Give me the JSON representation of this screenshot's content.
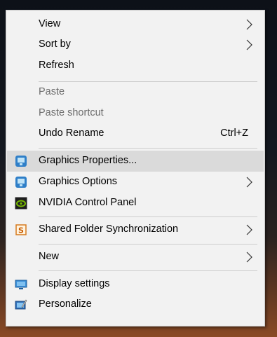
{
  "menu": {
    "items": [
      {
        "label": "View",
        "submenu": true
      },
      {
        "label": "Sort by",
        "submenu": true
      },
      {
        "label": "Refresh"
      },
      {
        "label": "Paste",
        "disabled": true
      },
      {
        "label": "Paste shortcut",
        "disabled": true
      },
      {
        "label": "Undo Rename",
        "shortcut": "Ctrl+Z"
      },
      {
        "label": "Graphics Properties...",
        "icon": "intel-graphics-icon",
        "highlighted": true
      },
      {
        "label": "Graphics Options",
        "icon": "intel-graphics-icon",
        "submenu": true
      },
      {
        "label": "NVIDIA Control Panel",
        "icon": "nvidia-icon"
      },
      {
        "label": "Shared Folder Synchronization",
        "icon": "shared-folder-sync-icon",
        "submenu": true
      },
      {
        "label": "New",
        "submenu": true
      },
      {
        "label": "Display settings",
        "icon": "display-icon"
      },
      {
        "label": "Personalize",
        "icon": "personalize-icon"
      }
    ]
  },
  "colors": {
    "menu_bg": "#f2f2f2",
    "hover_bg": "#dadada",
    "disabled_text": "#6d6d6d",
    "separator": "#cdcdcd"
  }
}
